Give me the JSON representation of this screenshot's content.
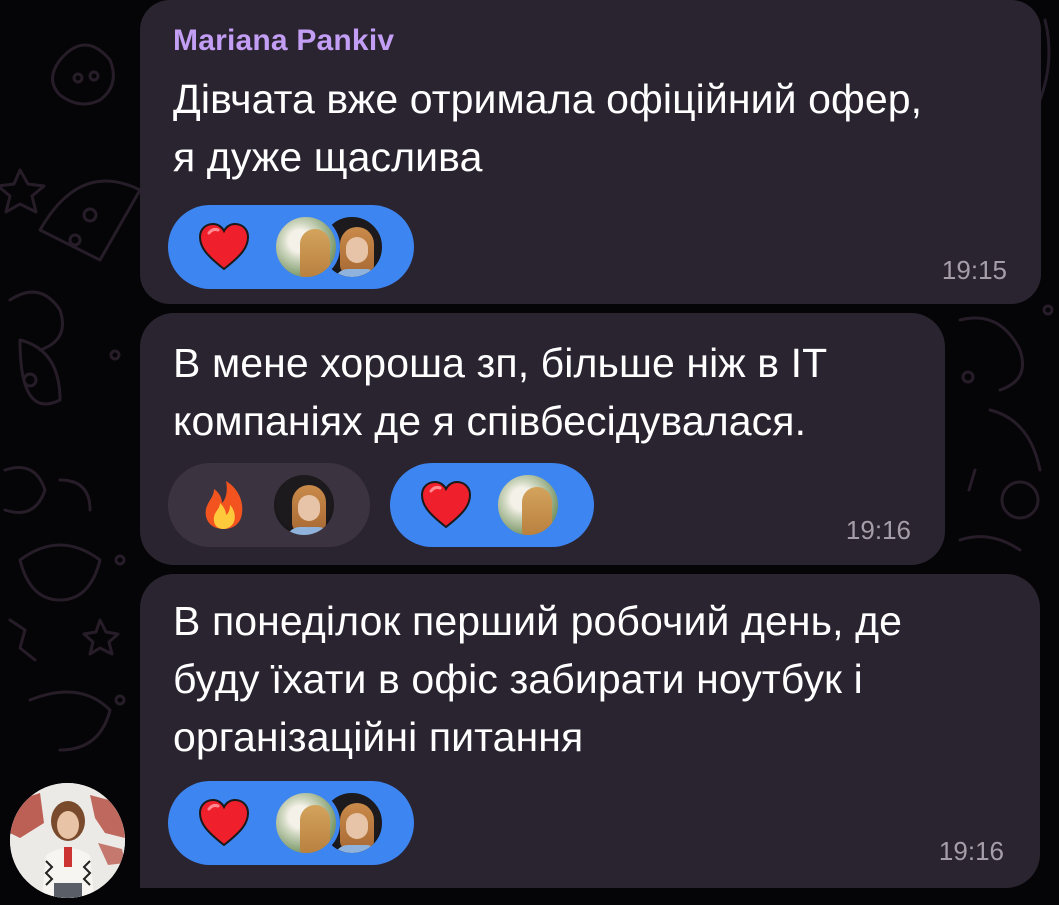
{
  "chat": {
    "sender_name": "Mariana Pankiv",
    "messages": [
      {
        "text": "Дівчата вже отримала офіційний офер,\nя дуже щаслива",
        "time": "19:15",
        "reactions": [
          {
            "emoji": "heart-icon",
            "active": true,
            "avatars": [
              "reactor-avatar-1",
              "reactor-avatar-2"
            ]
          }
        ]
      },
      {
        "text": "В мене хороша зп, більше ніж в IT\nкомпаніях де я співбесідувалася.",
        "time": "19:16",
        "reactions": [
          {
            "emoji": "fire-icon",
            "active": false,
            "avatars": [
              "reactor-avatar-2"
            ]
          },
          {
            "emoji": "heart-icon",
            "active": true,
            "avatars": [
              "reactor-avatar-1"
            ]
          }
        ]
      },
      {
        "text": "В понеділок перший робочий день, де\nбуду їхати в офіс забирати ноутбук і\nорганізаційні питання",
        "time": "19:16",
        "reactions": [
          {
            "emoji": "heart-icon",
            "active": true,
            "avatars": [
              "reactor-avatar-1",
              "reactor-avatar-2"
            ]
          }
        ]
      }
    ]
  },
  "colors": {
    "background": "#050406",
    "bubble": "#2a2430",
    "sender_name": "#c39ef5",
    "reaction_active": "#3d85f0",
    "reaction_inactive": "#3b3440",
    "timestamp": "#a59ea9"
  }
}
